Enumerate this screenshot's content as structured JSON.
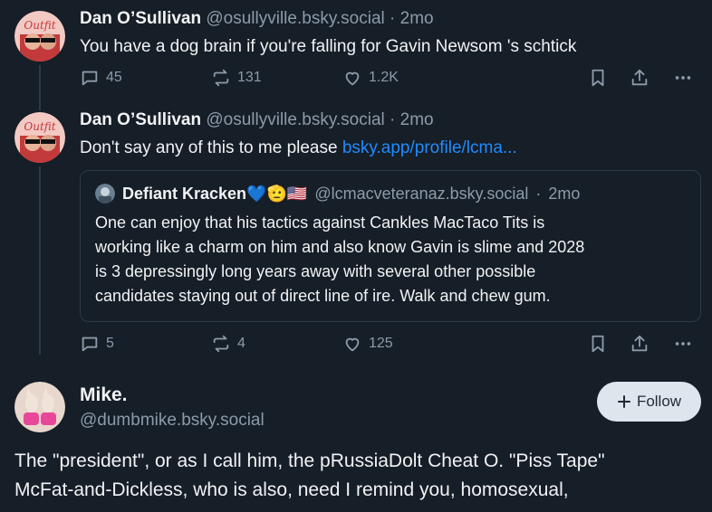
{
  "posts": [
    {
      "author": "Dan O’Sullivan",
      "handle": "@osullyville.bsky.social",
      "dot": "·",
      "time": "2mo",
      "text": "You have a dog brain if you're falling for Gavin Newsom 's schtick",
      "replies": "45",
      "reposts": "131",
      "likes": "1.2K"
    },
    {
      "author": "Dan O’Sullivan",
      "handle": "@osullyville.bsky.social",
      "dot": "·",
      "time": "2mo",
      "text": "Don't say any of this to me please ",
      "link": "bsky.app/profile/lcma...",
      "replies": "5",
      "reposts": "4",
      "likes": "125",
      "quote": {
        "author": "Defiant Kracken",
        "emoji": "💙🫡🇺🇸",
        "handle": "@lcmacveteranaz.bsky.social",
        "dot": "·",
        "time": "2mo",
        "lines": [
          "One can enjoy that his tactics against Cankles MacTaco Tits is",
          "working like a charm on him and also know Gavin is slime and 2028",
          "is 3 depressingly long years away with several other possible",
          "candidates staying out of direct line of ire. Walk and chew gum."
        ]
      }
    }
  ],
  "main_post": {
    "author": "Mike.",
    "handle": "@dumbmike.bsky.social",
    "follow_label": "Follow",
    "lines": [
      "The \"president\", or as I call him, the pRussiaDolt Cheat O. \"Piss Tape\"",
      "McFat-and-Dickless, who is also, need I remind you, homosexual,"
    ]
  },
  "icons": {
    "reply": "speech-bubble-icon",
    "repost": "repost-arrows-icon",
    "like": "heart-icon",
    "bookmark": "bookmark-icon",
    "share": "share-upload-icon",
    "more": "ellipsis-icon",
    "follow": "plus-icon"
  },
  "colors": {
    "background": "#161e27",
    "link": "#208bfe",
    "muted": "#8c9bab",
    "follow_bg": "#dfe5ec"
  }
}
